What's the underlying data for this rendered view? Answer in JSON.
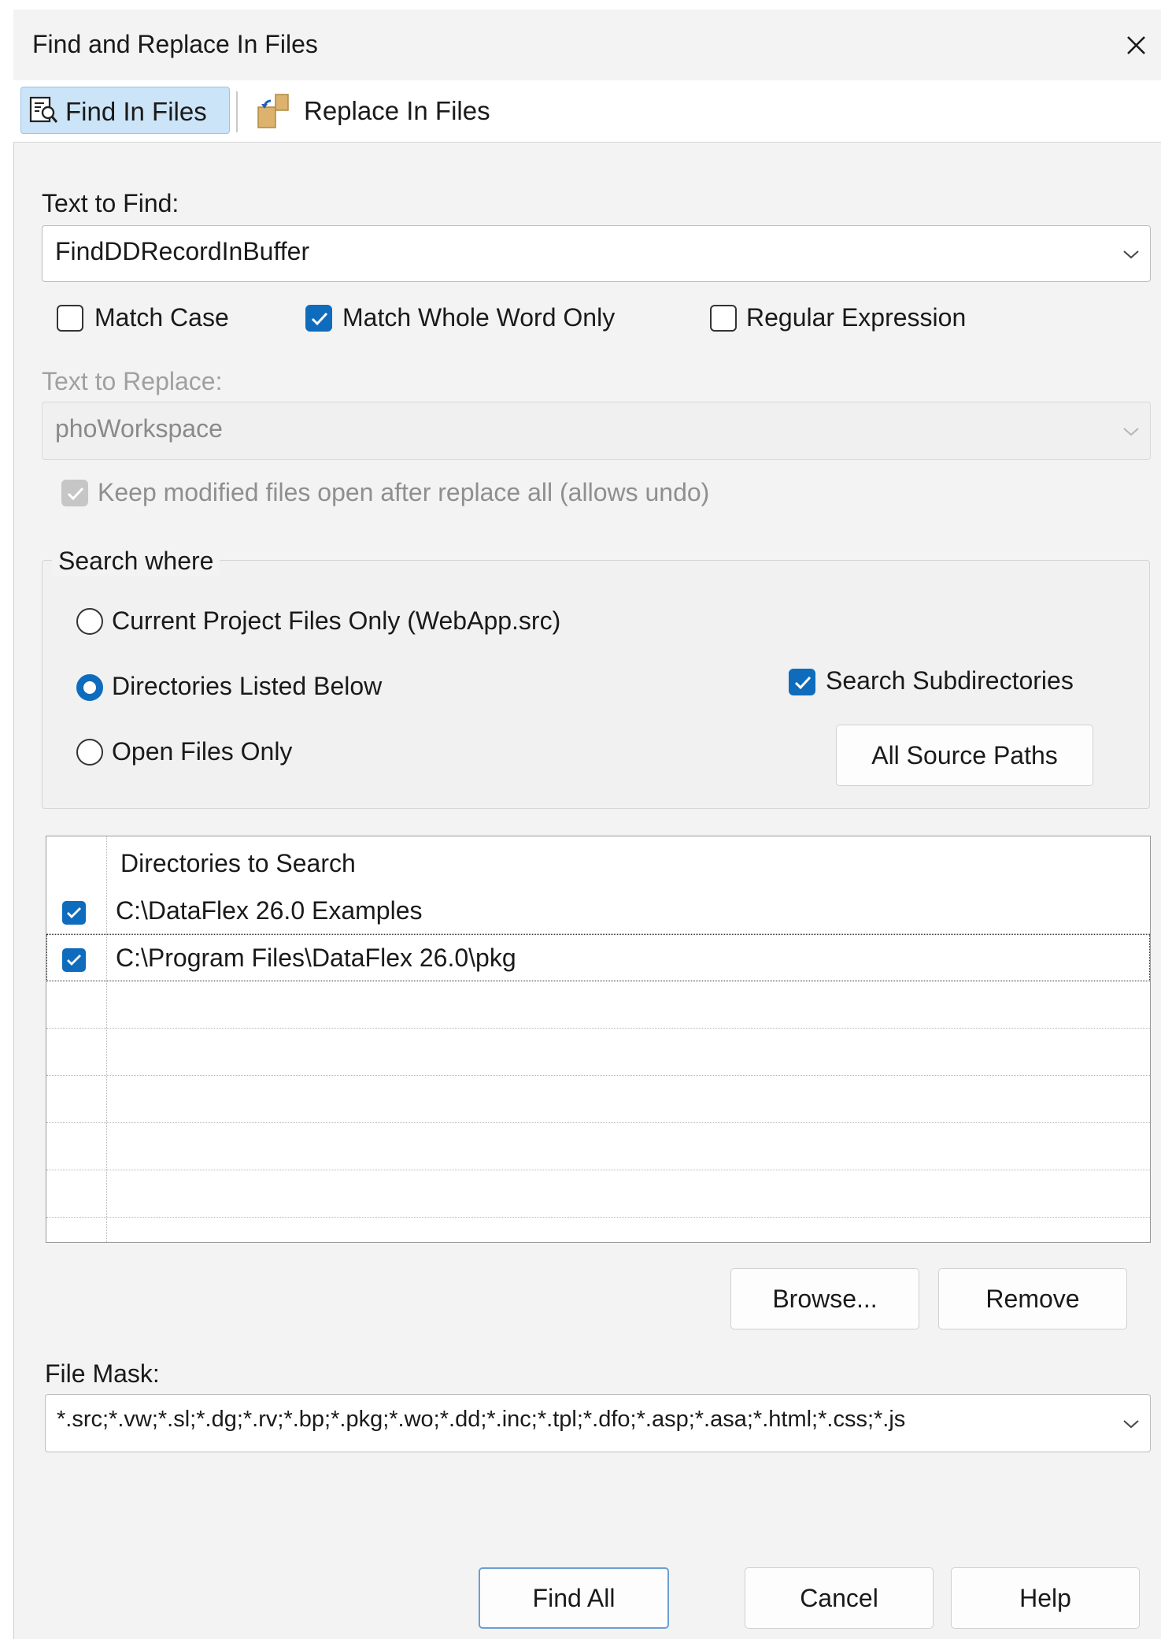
{
  "window": {
    "title": "Find and Replace In Files",
    "close_icon": "close-icon"
  },
  "tabs": [
    {
      "label": "Find In Files",
      "icon": "find-in-files-icon",
      "active": true
    },
    {
      "label": "Replace In Files",
      "icon": "replace-in-files-icon",
      "active": false
    }
  ],
  "find": {
    "label": "Text to Find:",
    "value": "FindDDRecordInBuffer",
    "options": [
      {
        "label": "Match Case",
        "checked": false
      },
      {
        "label": "Match Whole Word Only",
        "checked": true
      },
      {
        "label": "Regular Expression",
        "checked": false
      }
    ]
  },
  "replace": {
    "label": "Text to Replace:",
    "value": "phoWorkspace",
    "enabled": false,
    "keep_open_label": "Keep modified files open after replace all (allows undo)",
    "keep_open_checked": true
  },
  "search_where": {
    "title": "Search where",
    "options": [
      {
        "label": "Current Project Files Only (WebApp.src)",
        "selected": false
      },
      {
        "label": "Directories Listed Below",
        "selected": true
      },
      {
        "label": "Open Files Only",
        "selected": false
      }
    ],
    "subdirectories_label": "Search Subdirectories",
    "subdirectories_checked": true,
    "all_source_paths_label": "All Source Paths"
  },
  "directories": {
    "header": "Directories to Search",
    "rows": [
      {
        "path": "C:\\DataFlex 26.0 Examples",
        "checked": true
      },
      {
        "path": "C:\\Program Files\\DataFlex 26.0\\pkg",
        "checked": true
      }
    ],
    "browse_label": "Browse...",
    "remove_label": "Remove"
  },
  "file_mask": {
    "label": "File Mask:",
    "value": "*.src;*.vw;*.sl;*.dg;*.rv;*.bp;*.pkg;*.wo;*.dd;*.inc;*.tpl;*.dfo;*.asp;*.asa;*.html;*.css;*.js"
  },
  "footer": {
    "find_all_label": "Find All",
    "cancel_label": "Cancel",
    "help_label": "Help"
  },
  "colors": {
    "accent": "#0f6cbd",
    "tab_active_bg": "#cce4f7",
    "dialog_bg": "#f3f3f3"
  }
}
